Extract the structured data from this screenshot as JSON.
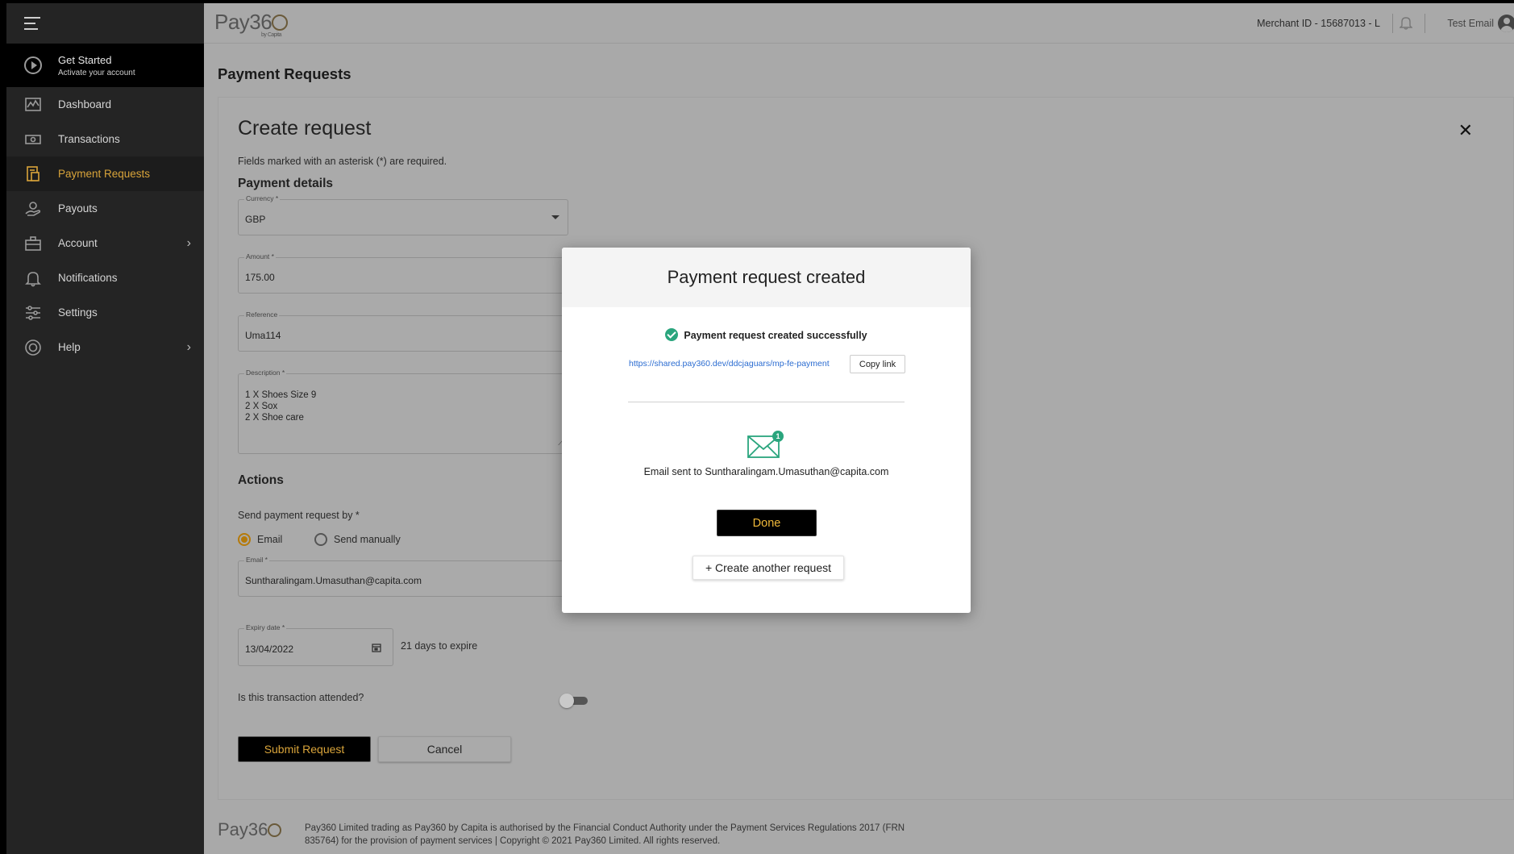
{
  "sidebar": {
    "get_started_title": "Get Started",
    "get_started_sub": "Activate your account",
    "items": [
      {
        "label": "Dashboard",
        "icon": "chart-icon"
      },
      {
        "label": "Transactions",
        "icon": "money-icon"
      },
      {
        "label": "Payment Requests",
        "icon": "payment-request-icon",
        "active": true
      },
      {
        "label": "Payouts",
        "icon": "payout-icon"
      },
      {
        "label": "Account",
        "icon": "briefcase-icon",
        "chevron": true
      },
      {
        "label": "Notifications",
        "icon": "bell-icon"
      },
      {
        "label": "Settings",
        "icon": "sliders-icon"
      },
      {
        "label": "Help",
        "icon": "lifebuoy-icon",
        "chevron": true
      }
    ]
  },
  "header": {
    "logo_text": "Pay36",
    "logo_by": "by Capita",
    "merchant": "Merchant ID - 15687013 - L",
    "user": "Test Email"
  },
  "page": {
    "title": "Payment Requests"
  },
  "form": {
    "title": "Create request",
    "hint": "Fields marked with an asterisk (*) are required.",
    "payment_details": "Payment details",
    "currency_label": "Currency *",
    "currency_value": "GBP",
    "amount_label": "Amount *",
    "amount_value": "175.00",
    "reference_label": "Reference",
    "reference_value": "Uma114",
    "description_label": "Description *",
    "description_lines": [
      "1 X Shoes Size 9",
      "2 X Sox",
      "2 X Shoe care"
    ],
    "actions": "Actions",
    "send_by_label": "Send payment request by *",
    "option_email": "Email",
    "option_manual": "Send manually",
    "email_label": "Email *",
    "email_value": "Suntharalingam.Umasuthan@capita.com",
    "expiry_label": "Expiry date *",
    "expiry_value": "13/04/2022",
    "expiry_note": "21 days to expire",
    "attended_label": "Is this transaction attended?",
    "submit": "Submit Request",
    "cancel": "Cancel"
  },
  "footer": {
    "logo_text": "Pay36",
    "text": "Pay360 Limited trading as Pay360 by Capita is authorised by the Financial Conduct Authority under the Payment Services Regulations 2017 (FRN 835764) for the provision of payment services | Copyright © 2021 Pay360 Limited. All rights reserved."
  },
  "modal": {
    "title": "Payment request created",
    "success": "Payment request created successfully",
    "link": "https://shared.pay360.dev/ddcjaguars/mp-fe-payment",
    "copy_label": "Copy link",
    "badge": "1",
    "email_sent": "Email sent to  Suntharalingam.Umasuthan@capita.com",
    "done": "Done",
    "create_another": "+ Create another request"
  },
  "colors": {
    "accent": "#d9a43a",
    "success": "#2aa57d",
    "link": "#2b6cd1"
  }
}
